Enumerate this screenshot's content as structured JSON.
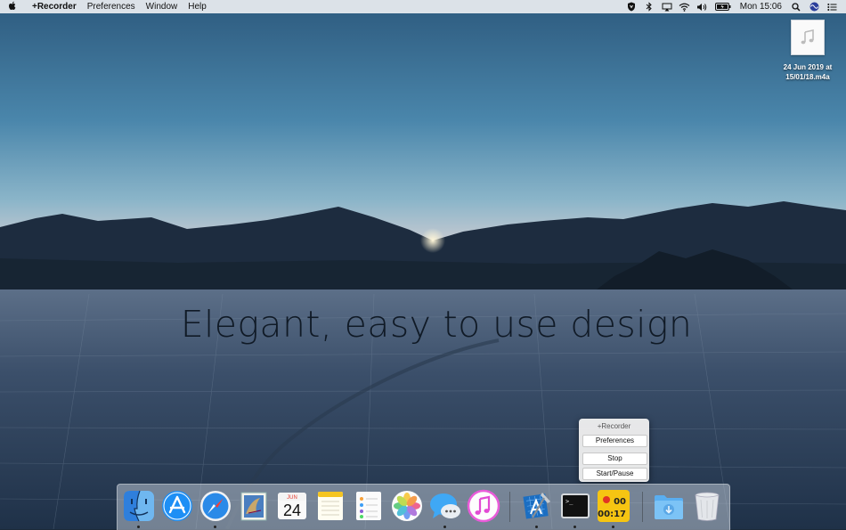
{
  "menubar": {
    "apple_icon": "apple-logo-icon",
    "app_name": "+Recorder",
    "menus": [
      "Preferences",
      "Window",
      "Help"
    ],
    "status_icons": [
      "shield-icon",
      "bluetooth-icon",
      "airplay-icon",
      "wifi-icon",
      "volume-icon",
      "battery-icon"
    ],
    "clock": "Mon 15:06",
    "right_icons": [
      "spotlight-search-icon",
      "siri-icon",
      "notification-center-icon"
    ]
  },
  "desktop_file": {
    "icon": "audio-file-icon",
    "name_line1": "24 Jun 2019 at",
    "name_line2": "15/01/18.m4a"
  },
  "headline": "Elegant, easy to use design",
  "recorder_menu": {
    "title": "+Recorder",
    "items": [
      "Preferences",
      "Stop",
      "Start/Pause"
    ]
  },
  "dock": {
    "apps": [
      {
        "name": "Finder",
        "icon": "finder-icon",
        "running": true
      },
      {
        "name": "App Store",
        "icon": "app-store-icon",
        "running": false
      },
      {
        "name": "Safari",
        "icon": "safari-icon",
        "running": true
      },
      {
        "name": "Mail",
        "icon": "mail-icon",
        "running": false
      },
      {
        "name": "Calendar",
        "icon": "calendar-icon",
        "running": false,
        "month": "JUN",
        "day": "24"
      },
      {
        "name": "Notes",
        "icon": "notes-icon",
        "running": false
      },
      {
        "name": "Reminders",
        "icon": "reminders-icon",
        "running": false
      },
      {
        "name": "Photos",
        "icon": "photos-icon",
        "running": false
      },
      {
        "name": "Messages",
        "icon": "messages-icon",
        "running": true
      },
      {
        "name": "iTunes",
        "icon": "itunes-icon",
        "running": false
      },
      {
        "name": "Xcode",
        "icon": "xcode-icon",
        "running": true
      },
      {
        "name": "Terminal",
        "icon": "terminal-icon",
        "running": true,
        "prompt": ">_"
      },
      {
        "name": "+Recorder",
        "icon": "recorder-icon",
        "running": true,
        "timer_top": "00",
        "timer_bottom": ":00:17"
      }
    ],
    "stack": {
      "name": "Downloads",
      "icon": "downloads-folder-icon"
    },
    "trash": {
      "name": "Trash",
      "icon": "trash-icon"
    }
  }
}
